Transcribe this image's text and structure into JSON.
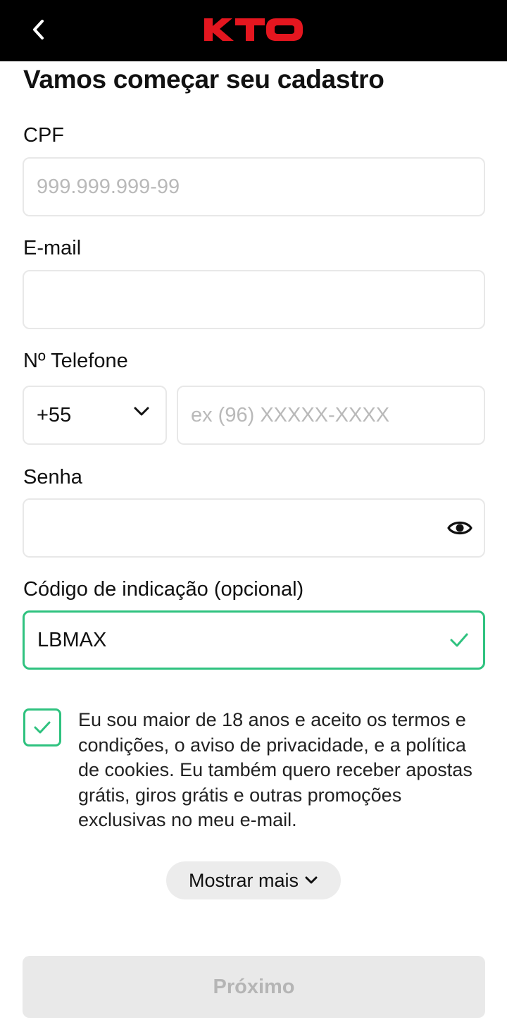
{
  "header": {
    "back_icon": "chevron-left-icon",
    "logo_text": "KTO",
    "logo_color": "#e4161f"
  },
  "form": {
    "title": "Vamos começar seu cadastro",
    "cpf": {
      "label": "CPF",
      "placeholder": "999.999.999-99",
      "value": ""
    },
    "email": {
      "label": "E-mail",
      "placeholder": "",
      "value": ""
    },
    "phone": {
      "label": "Nº Telefone",
      "country_code": "+55",
      "placeholder": "ex (96) XXXXX-XXXX",
      "value": ""
    },
    "password": {
      "label": "Senha",
      "value": "",
      "toggle_icon": "eye-icon"
    },
    "referral": {
      "label": "Código de indicação (opcional)",
      "value": "LBMAX",
      "valid": true,
      "valid_color": "#2fc27f"
    },
    "consent": {
      "checked": true,
      "text": "Eu sou maior de 18 anos e aceito os termos e condições, o aviso de privacidade, e a política de cookies. Eu também quero receber apostas grátis, giros grátis e outras promoções exclusivas no meu e-mail."
    },
    "show_more_label": "Mostrar mais",
    "next_label": "Próximo"
  }
}
